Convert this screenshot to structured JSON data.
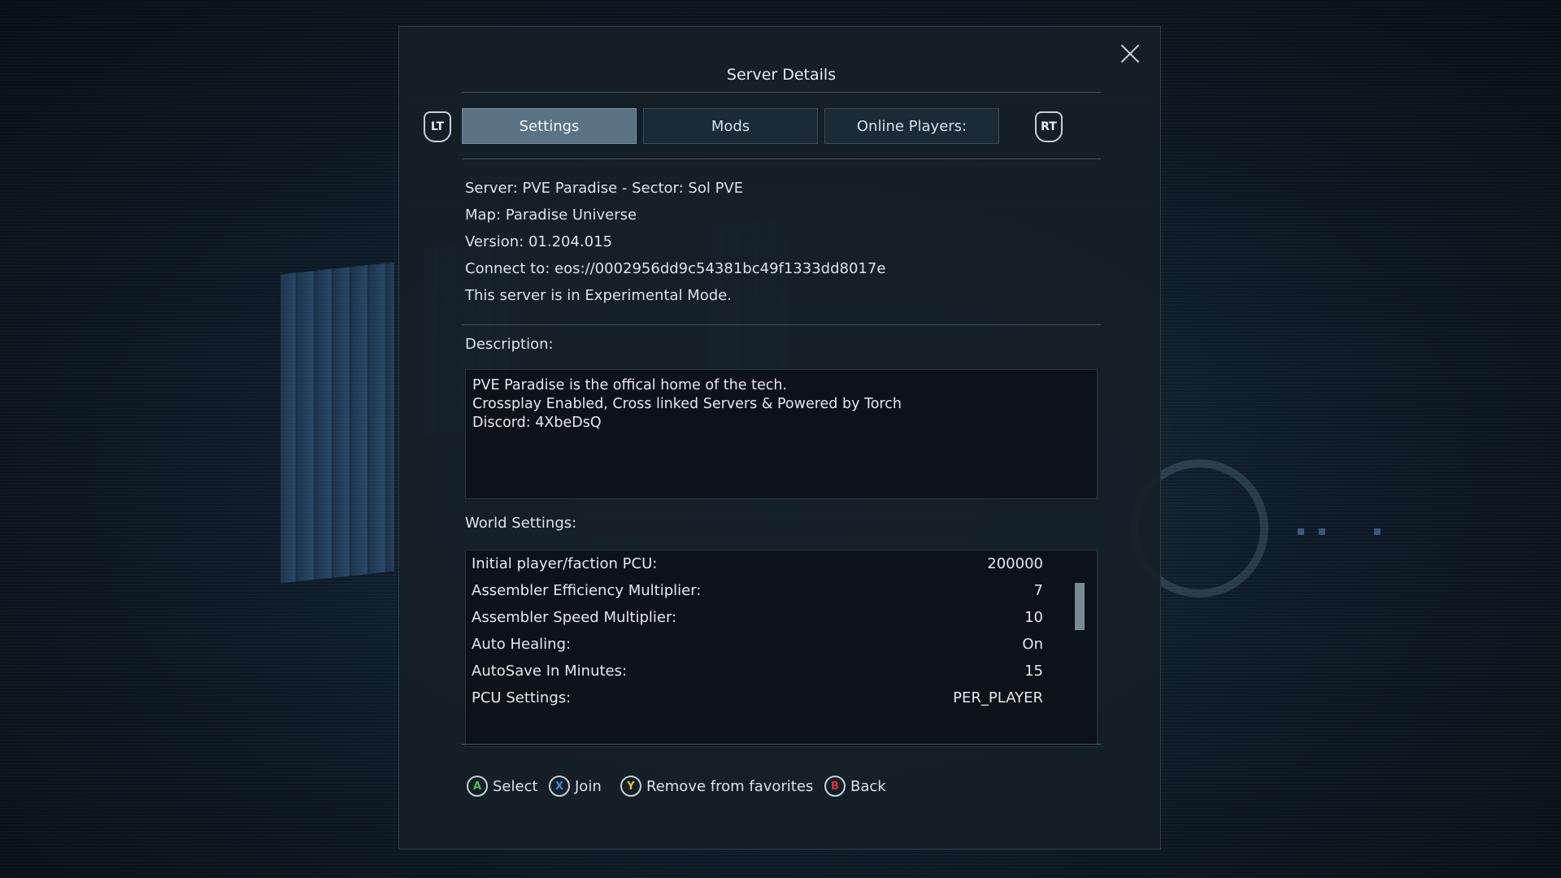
{
  "dialog": {
    "title": "Server Details"
  },
  "tabs": {
    "lt_label": "LT",
    "rt_label": "RT",
    "items": [
      {
        "label": "Settings"
      },
      {
        "label": "Mods"
      },
      {
        "label": "Online Players:"
      }
    ],
    "active": "Settings"
  },
  "server_info": {
    "server": "Server: PVE Paradise - Sector: Sol PVE",
    "map": "Map: Paradise Universe",
    "version": "Version: 01.204.015",
    "connect": "Connect to: eos://0002956dd9c54381bc49f1333dd8017e",
    "mode": "This server is in Experimental Mode."
  },
  "description": {
    "label": "Description:",
    "lines": [
      "PVE Paradise is the offical home of the tech.",
      "Crossplay Enabled, Cross linked Servers & Powered by Torch",
      "Discord: 4XbeDsQ"
    ]
  },
  "world_settings": {
    "label": "World Settings:",
    "rows": [
      {
        "name": "Initial player/faction PCU:",
        "value": "200000"
      },
      {
        "name": "Assembler Efficiency Multiplier:",
        "value": "7"
      },
      {
        "name": "Assembler Speed Multiplier:",
        "value": "10"
      },
      {
        "name": "Auto Healing:",
        "value": "On"
      },
      {
        "name": "AutoSave In Minutes:",
        "value": "15"
      },
      {
        "name": "PCU Settings:",
        "value": "PER_PLAYER"
      }
    ]
  },
  "footer": {
    "select": {
      "button": "A",
      "label": "Select"
    },
    "join": {
      "button": "X",
      "label": "Join"
    },
    "favorites": {
      "button": "Y",
      "label": "Remove from favorites"
    },
    "back": {
      "button": "B",
      "label": "Back"
    }
  }
}
